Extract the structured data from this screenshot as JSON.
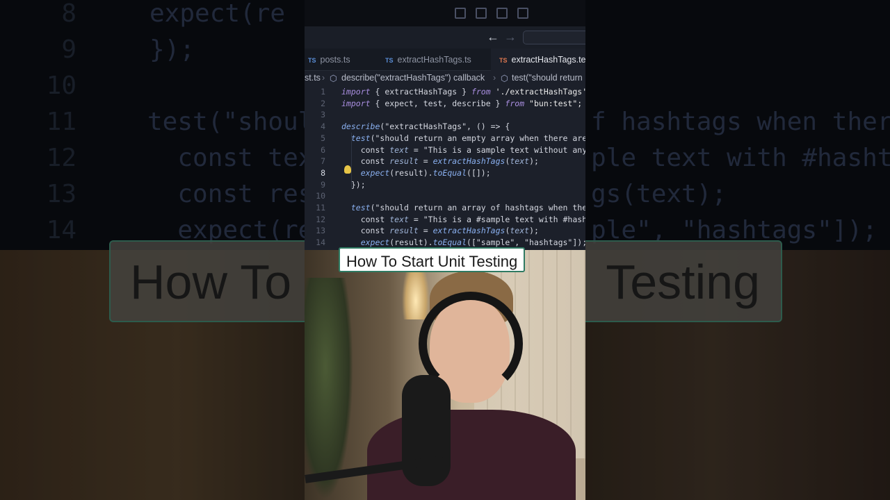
{
  "editor": {
    "tabs": [
      {
        "lang": "TS",
        "label": "posts.ts"
      },
      {
        "lang": "TS",
        "label": "extractHashTags.ts"
      },
      {
        "lang": "TS",
        "label": "extractHashTags.te"
      }
    ],
    "breadcrumb": {
      "file": "st.ts",
      "scope1": "describe(\"extractHashTags\") callback",
      "scope2": "test(\"should return"
    },
    "current_line": 8,
    "lines": [
      {
        "n": "1",
        "parts": [
          [
            "kw",
            "import"
          ],
          [
            "plain",
            " { extractHashTags } "
          ],
          [
            "kw",
            "from"
          ],
          [
            "str",
            " './extractHashTags';"
          ]
        ]
      },
      {
        "n": "2",
        "parts": [
          [
            "kw",
            "import"
          ],
          [
            "plain",
            " { expect, test, describe } "
          ],
          [
            "kw",
            "from"
          ],
          [
            "str",
            " \"bun:test\";"
          ]
        ]
      },
      {
        "n": "3",
        "parts": []
      },
      {
        "n": "4",
        "parts": [
          [
            "fn",
            "describe"
          ],
          [
            "plain",
            "(\"extractHashTags\", () => {"
          ]
        ]
      },
      {
        "n": "5",
        "parts": [
          [
            "plain",
            "  "
          ],
          [
            "fn",
            "test"
          ],
          [
            "plain",
            "(\"should return an empty array when there are n"
          ]
        ]
      },
      {
        "n": "6",
        "parts": [
          [
            "plain",
            "    const "
          ],
          [
            "var",
            "text"
          ],
          [
            "plain",
            " = \"This is a sample text without any h"
          ]
        ]
      },
      {
        "n": "7",
        "parts": [
          [
            "plain",
            "    const "
          ],
          [
            "var",
            "result"
          ],
          [
            "plain",
            " = "
          ],
          [
            "fn",
            "extractHashTags"
          ],
          [
            "plain",
            "("
          ],
          [
            "var",
            "text"
          ],
          [
            "plain",
            ");"
          ]
        ]
      },
      {
        "n": "8",
        "parts": [
          [
            "plain",
            "    "
          ],
          [
            "fn",
            "expect"
          ],
          [
            "plain",
            "(result)."
          ],
          [
            "fn",
            "toEqual"
          ],
          [
            "plain",
            "([]);"
          ]
        ]
      },
      {
        "n": "9",
        "parts": [
          [
            "plain",
            "  });"
          ]
        ]
      },
      {
        "n": "10",
        "parts": []
      },
      {
        "n": "11",
        "parts": [
          [
            "plain",
            "  "
          ],
          [
            "fn",
            "test"
          ],
          [
            "plain",
            "(\"should return an array of hashtags when there"
          ]
        ]
      },
      {
        "n": "12",
        "parts": [
          [
            "plain",
            "    const "
          ],
          [
            "var",
            "text"
          ],
          [
            "plain",
            " = \"This is a #sample text with #hashta"
          ]
        ]
      },
      {
        "n": "13",
        "parts": [
          [
            "plain",
            "    const "
          ],
          [
            "var",
            "result"
          ],
          [
            "plain",
            " = "
          ],
          [
            "fn",
            "extractHashTags"
          ],
          [
            "plain",
            "("
          ],
          [
            "var",
            "text"
          ],
          [
            "plain",
            ");"
          ]
        ]
      },
      {
        "n": "14",
        "parts": [
          [
            "plain",
            "    "
          ],
          [
            "fn",
            "expect"
          ],
          [
            "plain",
            "(result)."
          ],
          [
            "fn",
            "toEqual"
          ],
          [
            "plain",
            "([\"sample\", \"hashtags\"]);"
          ]
        ]
      }
    ]
  },
  "background_code": {
    "lines": [
      {
        "n": "8",
        "text": "expect(re"
      },
      {
        "n": "9",
        "text": "});"
      },
      {
        "n": "10",
        "text": ""
      },
      {
        "n": "11",
        "text": "test(\"shoul"
      },
      {
        "n": "12",
        "text": "  const tex"
      },
      {
        "n": "13",
        "text": "  const res"
      },
      {
        "n": "14",
        "text": "  expect(re"
      }
    ],
    "right_lines": [
      {
        "text": ""
      },
      {
        "text": ""
      },
      {
        "text": ""
      },
      {
        "text": "f hashtags when there"
      },
      {
        "text": "ple text with #hashta"
      },
      {
        "text": "gs(text);"
      },
      {
        "text": "ple\", \"hashtags\"]);"
      }
    ]
  },
  "caption": "How To Start Unit Testing",
  "background_banner": {
    "left": "How To",
    "right": "Testing"
  }
}
